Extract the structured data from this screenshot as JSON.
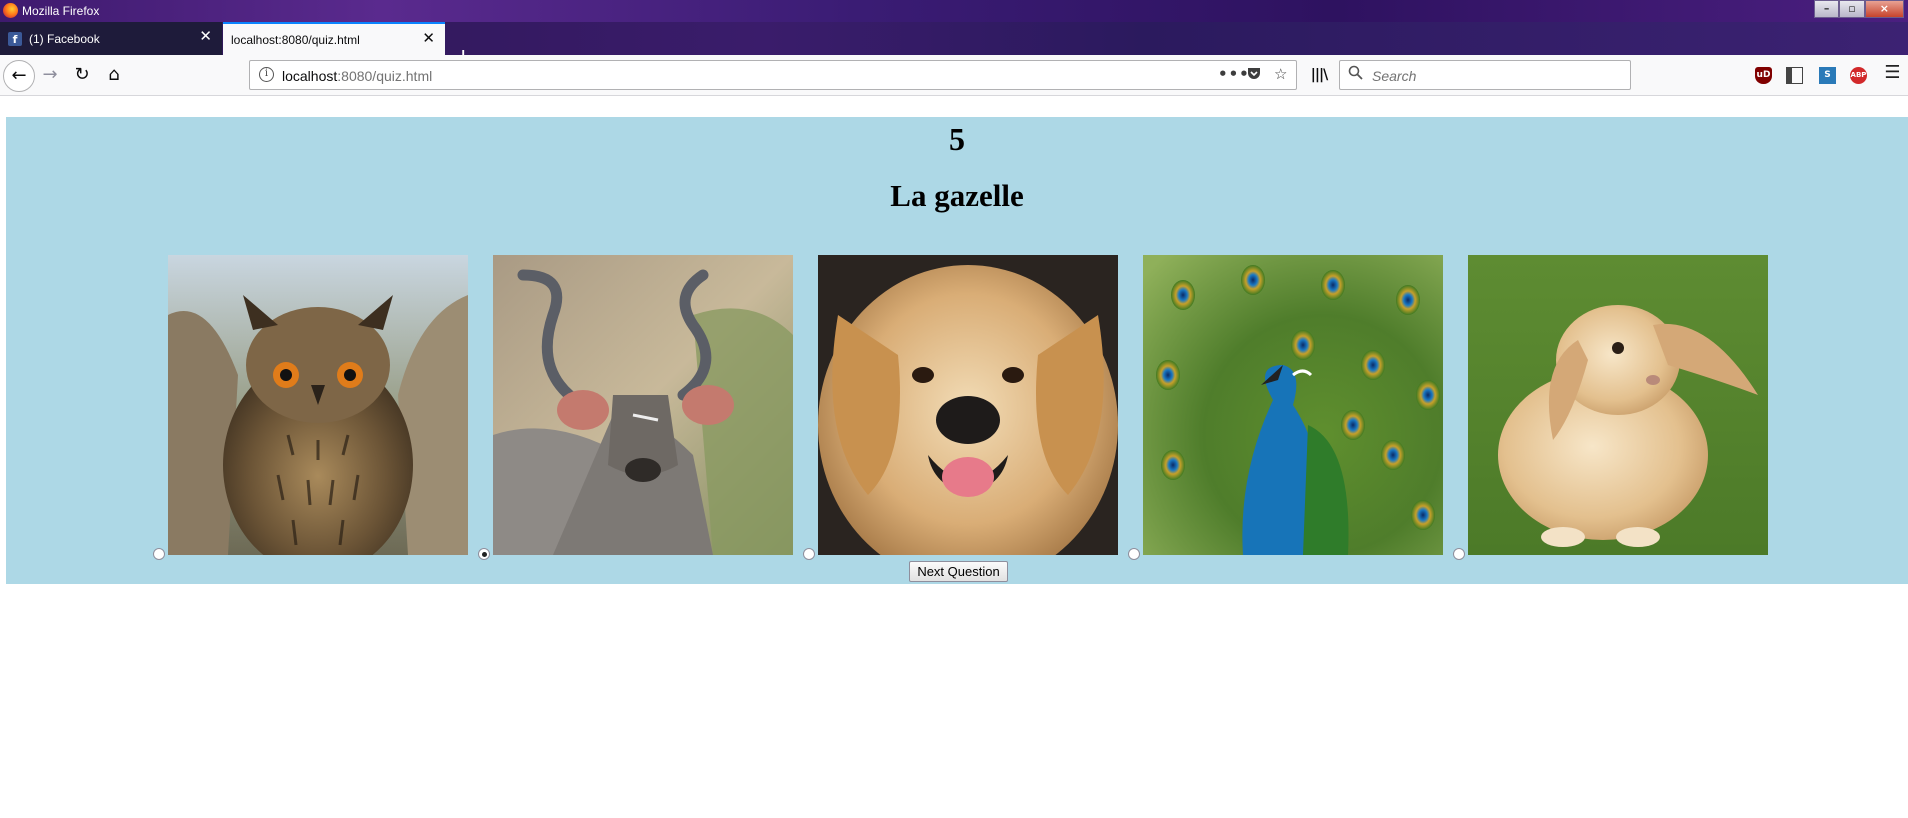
{
  "window": {
    "title": "Mozilla Firefox"
  },
  "tabs": [
    {
      "label": "(1) Facebook",
      "active": false
    },
    {
      "label": "localhost:8080/quiz.html",
      "active": true
    }
  ],
  "toolbar": {
    "url_host": "localhost",
    "url_rest": ":8080/quiz.html",
    "search_placeholder": "Search"
  },
  "quiz": {
    "question_number": "5",
    "question_text": "La gazelle",
    "choices": [
      {
        "animal": "owl",
        "selected": false
      },
      {
        "animal": "kudu",
        "selected": true
      },
      {
        "animal": "dog",
        "selected": false
      },
      {
        "animal": "peacock",
        "selected": false
      },
      {
        "animal": "rabbit",
        "selected": false
      }
    ],
    "next_label": "Next Question"
  },
  "colors": {
    "quiz_background": "#add8e6",
    "tab_accent": "#0a84ff"
  }
}
